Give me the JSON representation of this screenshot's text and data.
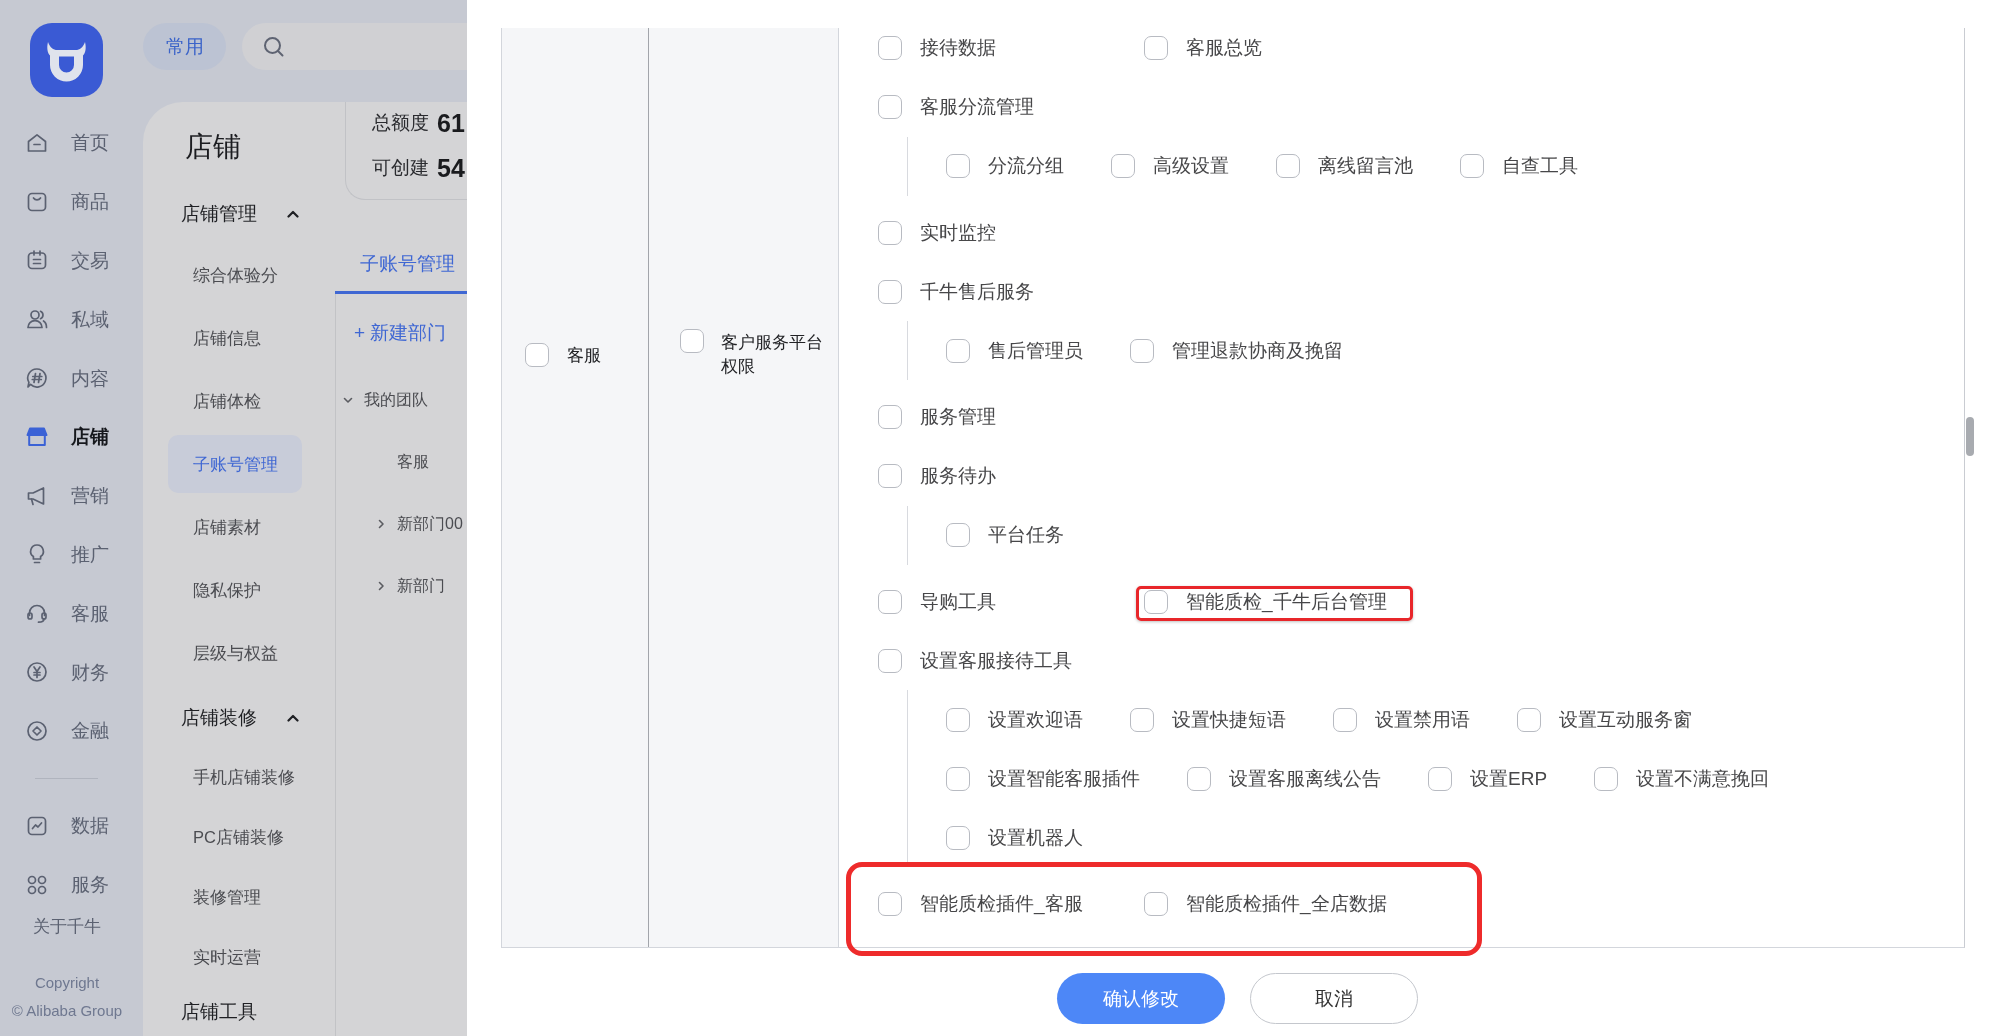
{
  "app_nav": {
    "items": [
      {
        "label": "首页",
        "selected": false
      },
      {
        "label": "商品",
        "selected": false
      },
      {
        "label": "交易",
        "selected": false
      },
      {
        "label": "私域",
        "selected": false
      },
      {
        "label": "内容",
        "selected": false
      },
      {
        "label": "店铺",
        "selected": true
      },
      {
        "label": "营销",
        "selected": false
      },
      {
        "label": "推广",
        "selected": false
      },
      {
        "label": "客服",
        "selected": false
      },
      {
        "label": "财务",
        "selected": false
      },
      {
        "label": "金融",
        "selected": false
      }
    ],
    "secondary_items": [
      {
        "label": "数据",
        "selected": false
      },
      {
        "label": "服务",
        "selected": false
      }
    ],
    "about_link": "关于千牛",
    "copyright": [
      "Copyright",
      "© Alibaba Group"
    ]
  },
  "top_bar": {
    "shortcut_button": "常用"
  },
  "store_menu": {
    "title": "店铺",
    "sections": [
      {
        "title": "店铺管理",
        "expanded": true,
        "items": [
          {
            "label": "综合体验分",
            "selected": false
          },
          {
            "label": "店铺信息",
            "selected": false
          },
          {
            "label": "店铺体检",
            "selected": false
          },
          {
            "label": "子账号管理",
            "selected": true
          },
          {
            "label": "店铺素材",
            "selected": false
          },
          {
            "label": "隐私保护",
            "selected": false
          },
          {
            "label": "层级与权益",
            "selected": false
          }
        ]
      },
      {
        "title": "店铺装修",
        "expanded": true,
        "items": [
          {
            "label": "手机店铺装修",
            "selected": false
          },
          {
            "label": "PC店铺装修",
            "selected": false
          },
          {
            "label": "装修管理",
            "selected": false
          },
          {
            "label": "实时运营",
            "selected": false
          }
        ]
      },
      {
        "title": "店铺工具"
      }
    ]
  },
  "account_panel": {
    "quota": [
      {
        "label": "总额度",
        "value": "61"
      },
      {
        "label": "可创建",
        "value": "54"
      }
    ],
    "tabs": [
      {
        "label": "子账号管理",
        "selected": true
      }
    ],
    "new_department_link": "+ 新建部门",
    "department_tree": [
      {
        "label": "我的团队",
        "expanded": true,
        "children": [
          {
            "label": "客服"
          },
          {
            "label": "新部门00",
            "expanded": false
          },
          {
            "label": "新部门",
            "expanded": false
          }
        ]
      }
    ]
  },
  "permission_dialog": {
    "table": {
      "rows": [
        {
          "column_1": {
            "label": "客服",
            "checked": false
          },
          "column_2": {
            "label": "客户服务平台权限",
            "checked": false
          },
          "column_3": [
            {
              "highlighted": false,
              "items": [
                {
                  "label": "接待数据",
                  "checked": false,
                  "highlighted": false
                },
                {
                  "label": "客服总览",
                  "checked": false,
                  "highlighted": false
                }
              ]
            },
            {
              "highlighted": false,
              "items": [
                {
                  "label": "客服分流管理",
                  "checked": false,
                  "highlighted": false,
                  "children": [
                    {
                      "label": "分流分组",
                      "checked": false,
                      "highlighted": false
                    },
                    {
                      "label": "高级设置",
                      "checked": false,
                      "highlighted": false
                    },
                    {
                      "label": "离线留言池",
                      "checked": false,
                      "highlighted": false
                    },
                    {
                      "label": "自查工具",
                      "checked": false,
                      "highlighted": false
                    }
                  ]
                }
              ]
            },
            {
              "highlighted": false,
              "items": [
                {
                  "label": "实时监控",
                  "checked": false,
                  "highlighted": false
                }
              ]
            },
            {
              "highlighted": false,
              "items": [
                {
                  "label": "千牛售后服务",
                  "checked": false,
                  "highlighted": false,
                  "children": [
                    {
                      "label": "售后管理员",
                      "checked": false,
                      "highlighted": false
                    },
                    {
                      "label": "管理退款协商及挽留",
                      "checked": false,
                      "highlighted": false
                    }
                  ]
                }
              ]
            },
            {
              "highlighted": false,
              "items": [
                {
                  "label": "服务管理",
                  "checked": false,
                  "highlighted": false
                }
              ]
            },
            {
              "highlighted": false,
              "items": [
                {
                  "label": "服务待办",
                  "checked": false,
                  "highlighted": false,
                  "children": [
                    {
                      "label": "平台任务",
                      "checked": false,
                      "highlighted": false
                    }
                  ]
                }
              ]
            },
            {
              "highlighted": false,
              "items": [
                {
                  "label": "导购工具",
                  "checked": false,
                  "highlighted": false
                },
                {
                  "label": "智能质检_千牛后台管理",
                  "checked": false,
                  "highlighted": true
                }
              ]
            },
            {
              "highlighted": false,
              "items": [
                {
                  "label": "设置客服接待工具",
                  "checked": false,
                  "highlighted": false,
                  "children": [
                    {
                      "label": "设置欢迎语",
                      "checked": false,
                      "highlighted": false
                    },
                    {
                      "label": "设置快捷短语",
                      "checked": false,
                      "highlighted": false
                    },
                    {
                      "label": "设置禁用语",
                      "checked": false,
                      "highlighted": false
                    },
                    {
                      "label": "设置互动服务窗",
                      "checked": false,
                      "highlighted": false
                    },
                    {
                      "label": "设置智能客服插件",
                      "checked": false,
                      "highlighted": false
                    },
                    {
                      "label": "设置客服离线公告",
                      "checked": false,
                      "highlighted": false
                    },
                    {
                      "label": "设置ERP",
                      "checked": false,
                      "highlighted": false
                    },
                    {
                      "label": "设置不满意挽回",
                      "checked": false,
                      "highlighted": false
                    },
                    {
                      "label": "设置机器人",
                      "checked": false,
                      "highlighted": false
                    }
                  ]
                }
              ]
            },
            {
              "highlighted": true,
              "items": [
                {
                  "label": "智能质检插件_客服",
                  "checked": false,
                  "highlighted": false
                },
                {
                  "label": "智能质检插件_全店数据",
                  "checked": false,
                  "highlighted": false
                }
              ]
            }
          ]
        }
      ]
    },
    "buttons": [
      {
        "label": "确认修改",
        "kind": "primary"
      },
      {
        "label": "取消",
        "kind": "secondary"
      }
    ]
  }
}
